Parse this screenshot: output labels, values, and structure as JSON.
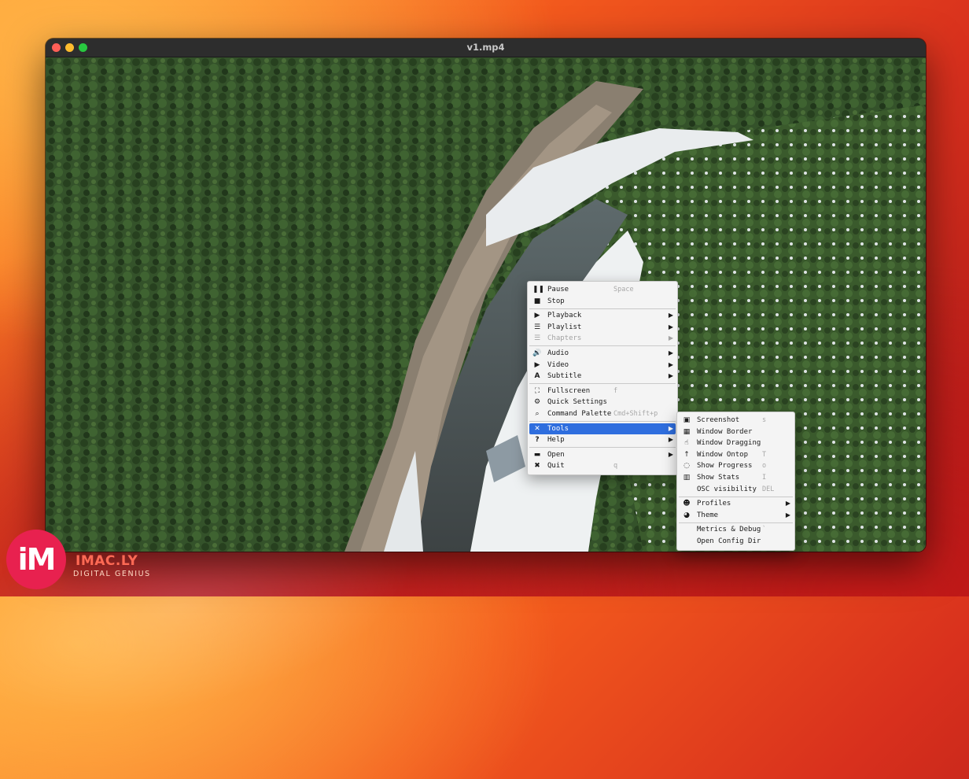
{
  "window": {
    "title": "v1.mp4"
  },
  "main_menu": {
    "items": [
      {
        "icon": "pause-icon",
        "glyph": "❚❚",
        "label": "Pause",
        "shortcut": "Space"
      },
      {
        "icon": "stop-icon",
        "glyph": "■",
        "label": "Stop",
        "shortcut": ""
      },
      {
        "icon": "play-circle-icon",
        "glyph": "▶",
        "label": "Playback",
        "submenu": true
      },
      {
        "icon": "playlist-icon",
        "glyph": "☰",
        "label": "Playlist",
        "submenu": true
      },
      {
        "icon": "chapters-icon",
        "glyph": "☰",
        "label": "Chapters",
        "submenu": true,
        "disabled": true
      },
      {
        "icon": "audio-icon",
        "glyph": "🔊",
        "label": "Audio",
        "submenu": true
      },
      {
        "icon": "video-camera-icon",
        "glyph": "▶",
        "label": "Video",
        "submenu": true
      },
      {
        "icon": "subtitle-icon",
        "glyph": "A",
        "label": "Subtitle",
        "submenu": true
      },
      {
        "icon": "fullscreen-icon",
        "glyph": "⛶",
        "label": "Fullscreen",
        "shortcut": "f"
      },
      {
        "icon": "settings-icon",
        "glyph": "⚙",
        "label": "Quick Settings",
        "shortcut": ""
      },
      {
        "icon": "search-icon",
        "glyph": "⌕",
        "label": "Command Palette",
        "shortcut": "Cmd+Shift+p"
      },
      {
        "icon": "tools-icon",
        "glyph": "✕",
        "label": "Tools",
        "submenu": true,
        "active": true
      },
      {
        "icon": "help-icon",
        "glyph": "?",
        "label": "Help",
        "submenu": true
      },
      {
        "icon": "folder-icon",
        "glyph": "▬",
        "label": "Open",
        "submenu": true
      },
      {
        "icon": "quit-icon",
        "glyph": "✖",
        "label": "Quit",
        "shortcut": "q"
      }
    ]
  },
  "tools_menu": {
    "items": [
      {
        "icon": "screenshot-icon",
        "glyph": "▣",
        "label": "Screenshot",
        "shortcut": "s"
      },
      {
        "icon": "window-border-icon",
        "glyph": "▦",
        "label": "Window Border",
        "shortcut": ""
      },
      {
        "icon": "hand-pointer-icon",
        "glyph": "☝",
        "label": "Window Dragging",
        "shortcut": ""
      },
      {
        "icon": "arrow-up-icon",
        "glyph": "↑",
        "label": "Window Ontop",
        "shortcut": "T"
      },
      {
        "icon": "progress-spinner-icon",
        "glyph": "◌",
        "label": "Show Progress",
        "shortcut": "o"
      },
      {
        "icon": "stats-chart-icon",
        "glyph": "▥",
        "label": "Show Stats",
        "shortcut": "I"
      },
      {
        "icon": "",
        "glyph": "",
        "label": "OSC visibility",
        "shortcut": "DEL"
      },
      {
        "icon": "profiles-icon",
        "glyph": "☻",
        "label": "Profiles",
        "submenu": true
      },
      {
        "icon": "palette-icon",
        "glyph": "◕",
        "label": "Theme",
        "submenu": true
      },
      {
        "icon": "",
        "glyph": "",
        "label": "Metrics & Debug",
        "shortcut": "`"
      },
      {
        "icon": "",
        "glyph": "",
        "label": "Open Config Dir",
        "shortcut": ""
      }
    ]
  },
  "watermark": {
    "logo": "iM",
    "name": "IMAC.LY",
    "tagline": "DIGITAL GENIUS"
  }
}
